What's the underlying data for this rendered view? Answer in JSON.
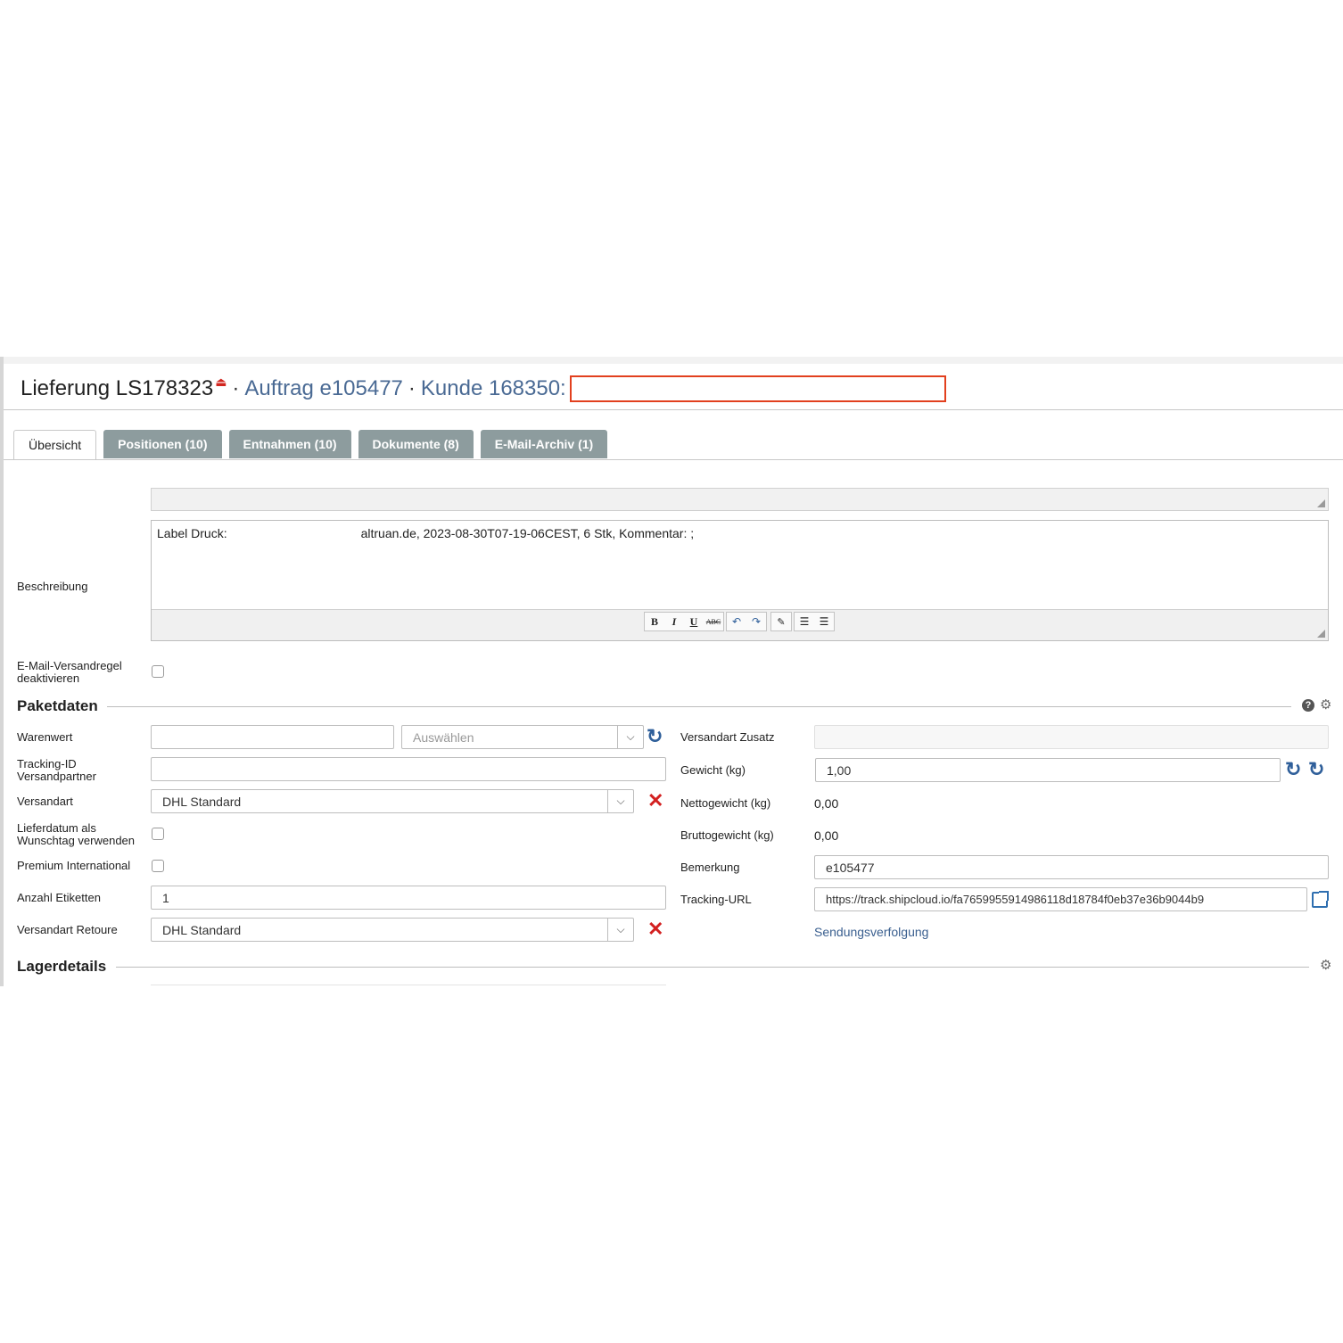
{
  "header": {
    "title": "Lieferung LS178323",
    "pdf_icon": "pdf-icon",
    "separator": "·",
    "order_link": "Auftrag e105477",
    "customer_link": "Kunde 168350:"
  },
  "tabs": [
    {
      "label": "Übersicht"
    },
    {
      "label": "Positionen (10)"
    },
    {
      "label": "Entnahmen (10)"
    },
    {
      "label": "Dokumente (8)"
    },
    {
      "label": "E-Mail-Archiv (1)"
    }
  ],
  "beschreibung": {
    "label": "Beschreibung",
    "text_left": "Label Druck:",
    "text_right": "altruan.de, 2023-08-30T07-19-06CEST, 6 Stk, Kommentar: ;",
    "toolbar": {
      "bold": "B",
      "italic": "I",
      "underline": "U",
      "strike": "ABC",
      "undo": "↶",
      "redo": "↷",
      "clear": "🧹",
      "bullets": "☰",
      "numbered": "☰"
    }
  },
  "email_rule": {
    "label_line1": "E-Mail-Versandregel",
    "label_line2": "deaktivieren"
  },
  "paketdaten": {
    "title": "Paketdaten",
    "help": "?",
    "warenwert": {
      "label": "Warenwert",
      "value": "",
      "currency_placeholder": "Auswählen"
    },
    "tracking_id": {
      "label_line1": "Tracking-ID",
      "label_line2": "Versandpartner",
      "value": ""
    },
    "versandart": {
      "label": "Versandart",
      "value": "DHL Standard"
    },
    "lieferdatum": {
      "label_line1": "Lieferdatum als",
      "label_line2": "Wunschtag verwenden"
    },
    "premium": {
      "label": "Premium International"
    },
    "etiketten": {
      "label": "Anzahl Etiketten",
      "value": "1"
    },
    "retoure": {
      "label": "Versandart Retoure",
      "value": "DHL Standard"
    },
    "zusatz": {
      "label": "Versandart Zusatz",
      "value": ""
    },
    "gewicht": {
      "label": "Gewicht (kg)",
      "value": "1,00"
    },
    "netto": {
      "label": "Nettogewicht (kg)",
      "value": "0,00"
    },
    "brutto": {
      "label": "Bruttogewicht (kg)",
      "value": "0,00"
    },
    "bemerkung": {
      "label": "Bemerkung",
      "value": "e105477"
    },
    "tracking_url": {
      "label": "Tracking-URL",
      "value": "https://track.shipcloud.io/fa7659955914986118d18784f0eb37e36b9044b9"
    },
    "sendungsverfolgung": "Sendungsverfolgung"
  },
  "lagerdetails": {
    "title": "Lagerdetails"
  },
  "colors": {
    "accent": "#4a6a94",
    "tab_bg": "#8d9c9e",
    "danger": "#d32020",
    "highlight_box": "#e2401e"
  }
}
